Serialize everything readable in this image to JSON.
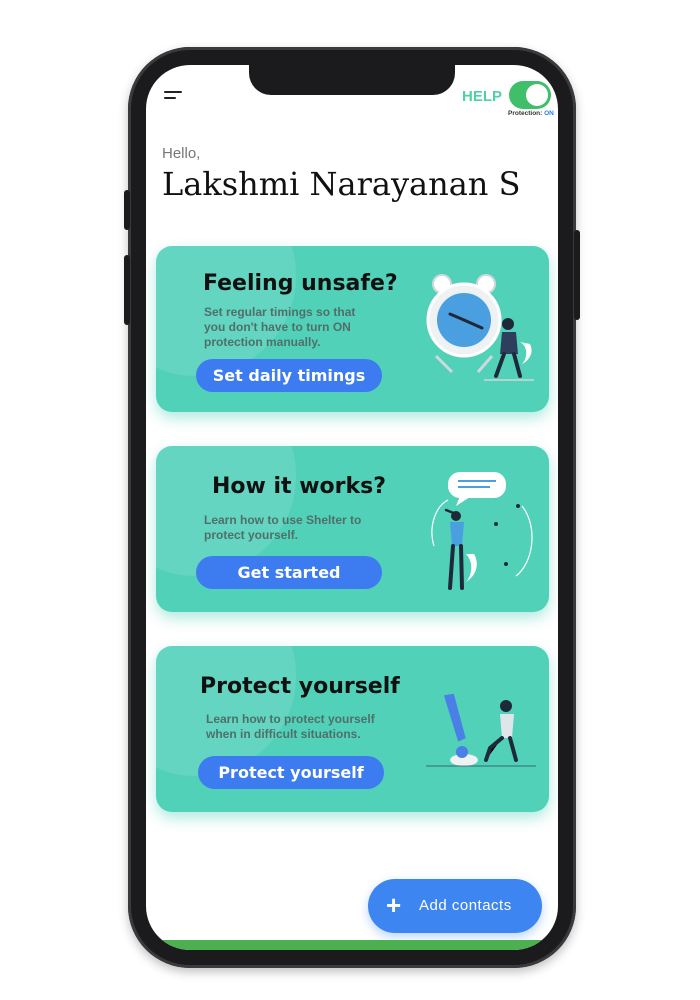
{
  "header": {
    "help_label": "HELP",
    "protection_prefix": "Protection:",
    "protection_status": "ON"
  },
  "greeting": {
    "hello": "Hello,",
    "user_name": "Lakshmi Narayanan S"
  },
  "cards": [
    {
      "title": "Feeling unsafe?",
      "description": "Set regular timings so that you don't have to turn ON protection manually.",
      "button": "Set daily timings",
      "illustration": "clock-person-illustration"
    },
    {
      "title": "How it works?",
      "description": "Learn how to use Shelter to protect yourself.",
      "button": "Get started",
      "illustration": "person-message-illustration"
    },
    {
      "title": "Protect yourself",
      "description": "Learn how to protect yourself when in difficult situations.",
      "button": "Protect yourself",
      "illustration": "exclamation-person-illustration"
    }
  ],
  "fab": {
    "icon": "plus-icon",
    "label": "Add contacts"
  },
  "colors": {
    "card": "#52d1b9",
    "button": "#3d7cf0",
    "help": "#4fd1a5",
    "toggle": "#3fbf6a"
  }
}
